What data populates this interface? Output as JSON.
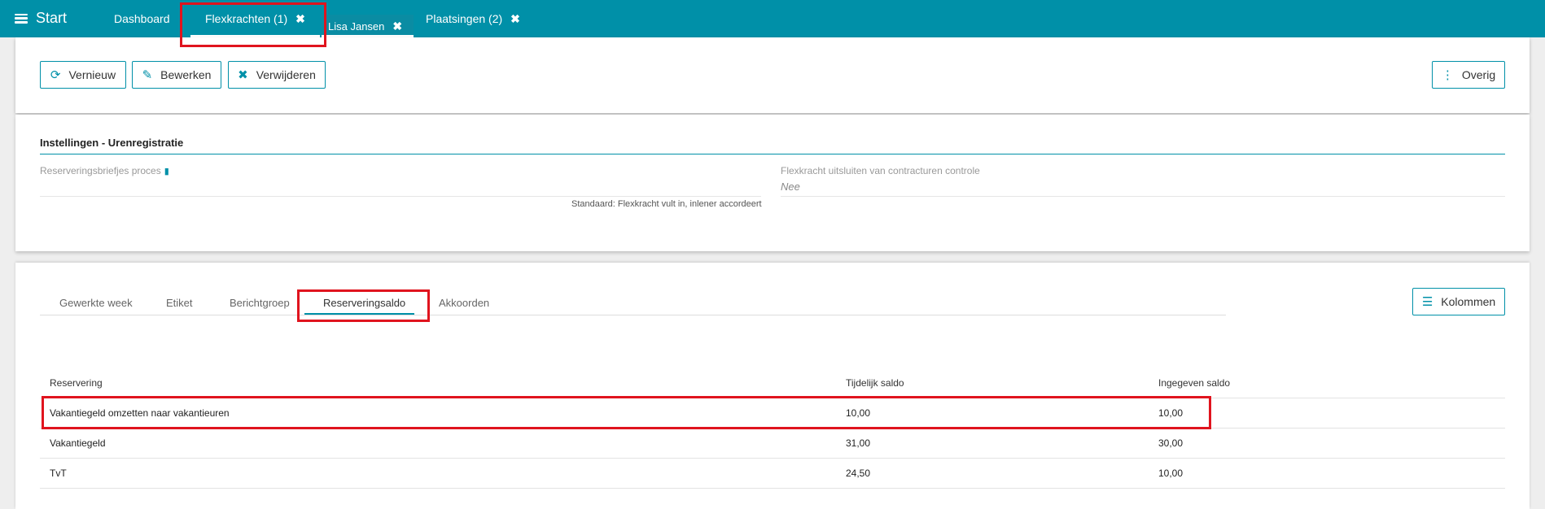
{
  "topbar": {
    "start_label": "Start",
    "tabs": [
      {
        "label": "Dashboard",
        "closable": false
      },
      {
        "label": "Flexkrachten (1)",
        "closable": true
      },
      {
        "label": "Lisa Jansen",
        "closable": true
      },
      {
        "label": "Plaatsingen (2)",
        "closable": true
      }
    ],
    "close_glyph": "✖"
  },
  "toolbar": {
    "refresh_label": "Vernieuw",
    "edit_label": "Bewerken",
    "delete_label": "Verwijderen",
    "more_label": "Overig"
  },
  "settings": {
    "title": "Instellingen - Urenregistratie",
    "field1_label": "Reserveringsbriefjes proces",
    "field1_hint": "Standaard: Flexkracht vult in, inlener accordeert",
    "field2_label": "Flexkracht uitsluiten van contracturen controle",
    "field2_value": "Nee"
  },
  "subtabs": {
    "items": [
      "Gewerkte week",
      "Etiket",
      "Berichtgroep",
      "Reserveringsaldo",
      "Akkoorden"
    ],
    "active": "Reserveringsaldo",
    "columns_button": "Kolommen"
  },
  "table": {
    "headers": [
      "Reservering",
      "Tijdelijk saldo",
      "Ingegeven saldo"
    ],
    "rows": [
      [
        "Vakantiegeld omzetten naar vakantieuren",
        "10,00",
        "10,00"
      ],
      [
        "Vakantiegeld",
        "31,00",
        "30,00"
      ],
      [
        "TvT",
        "24,50",
        "10,00"
      ]
    ]
  },
  "colors": {
    "brand": "#0090a8",
    "highlight": "#e0141e"
  }
}
